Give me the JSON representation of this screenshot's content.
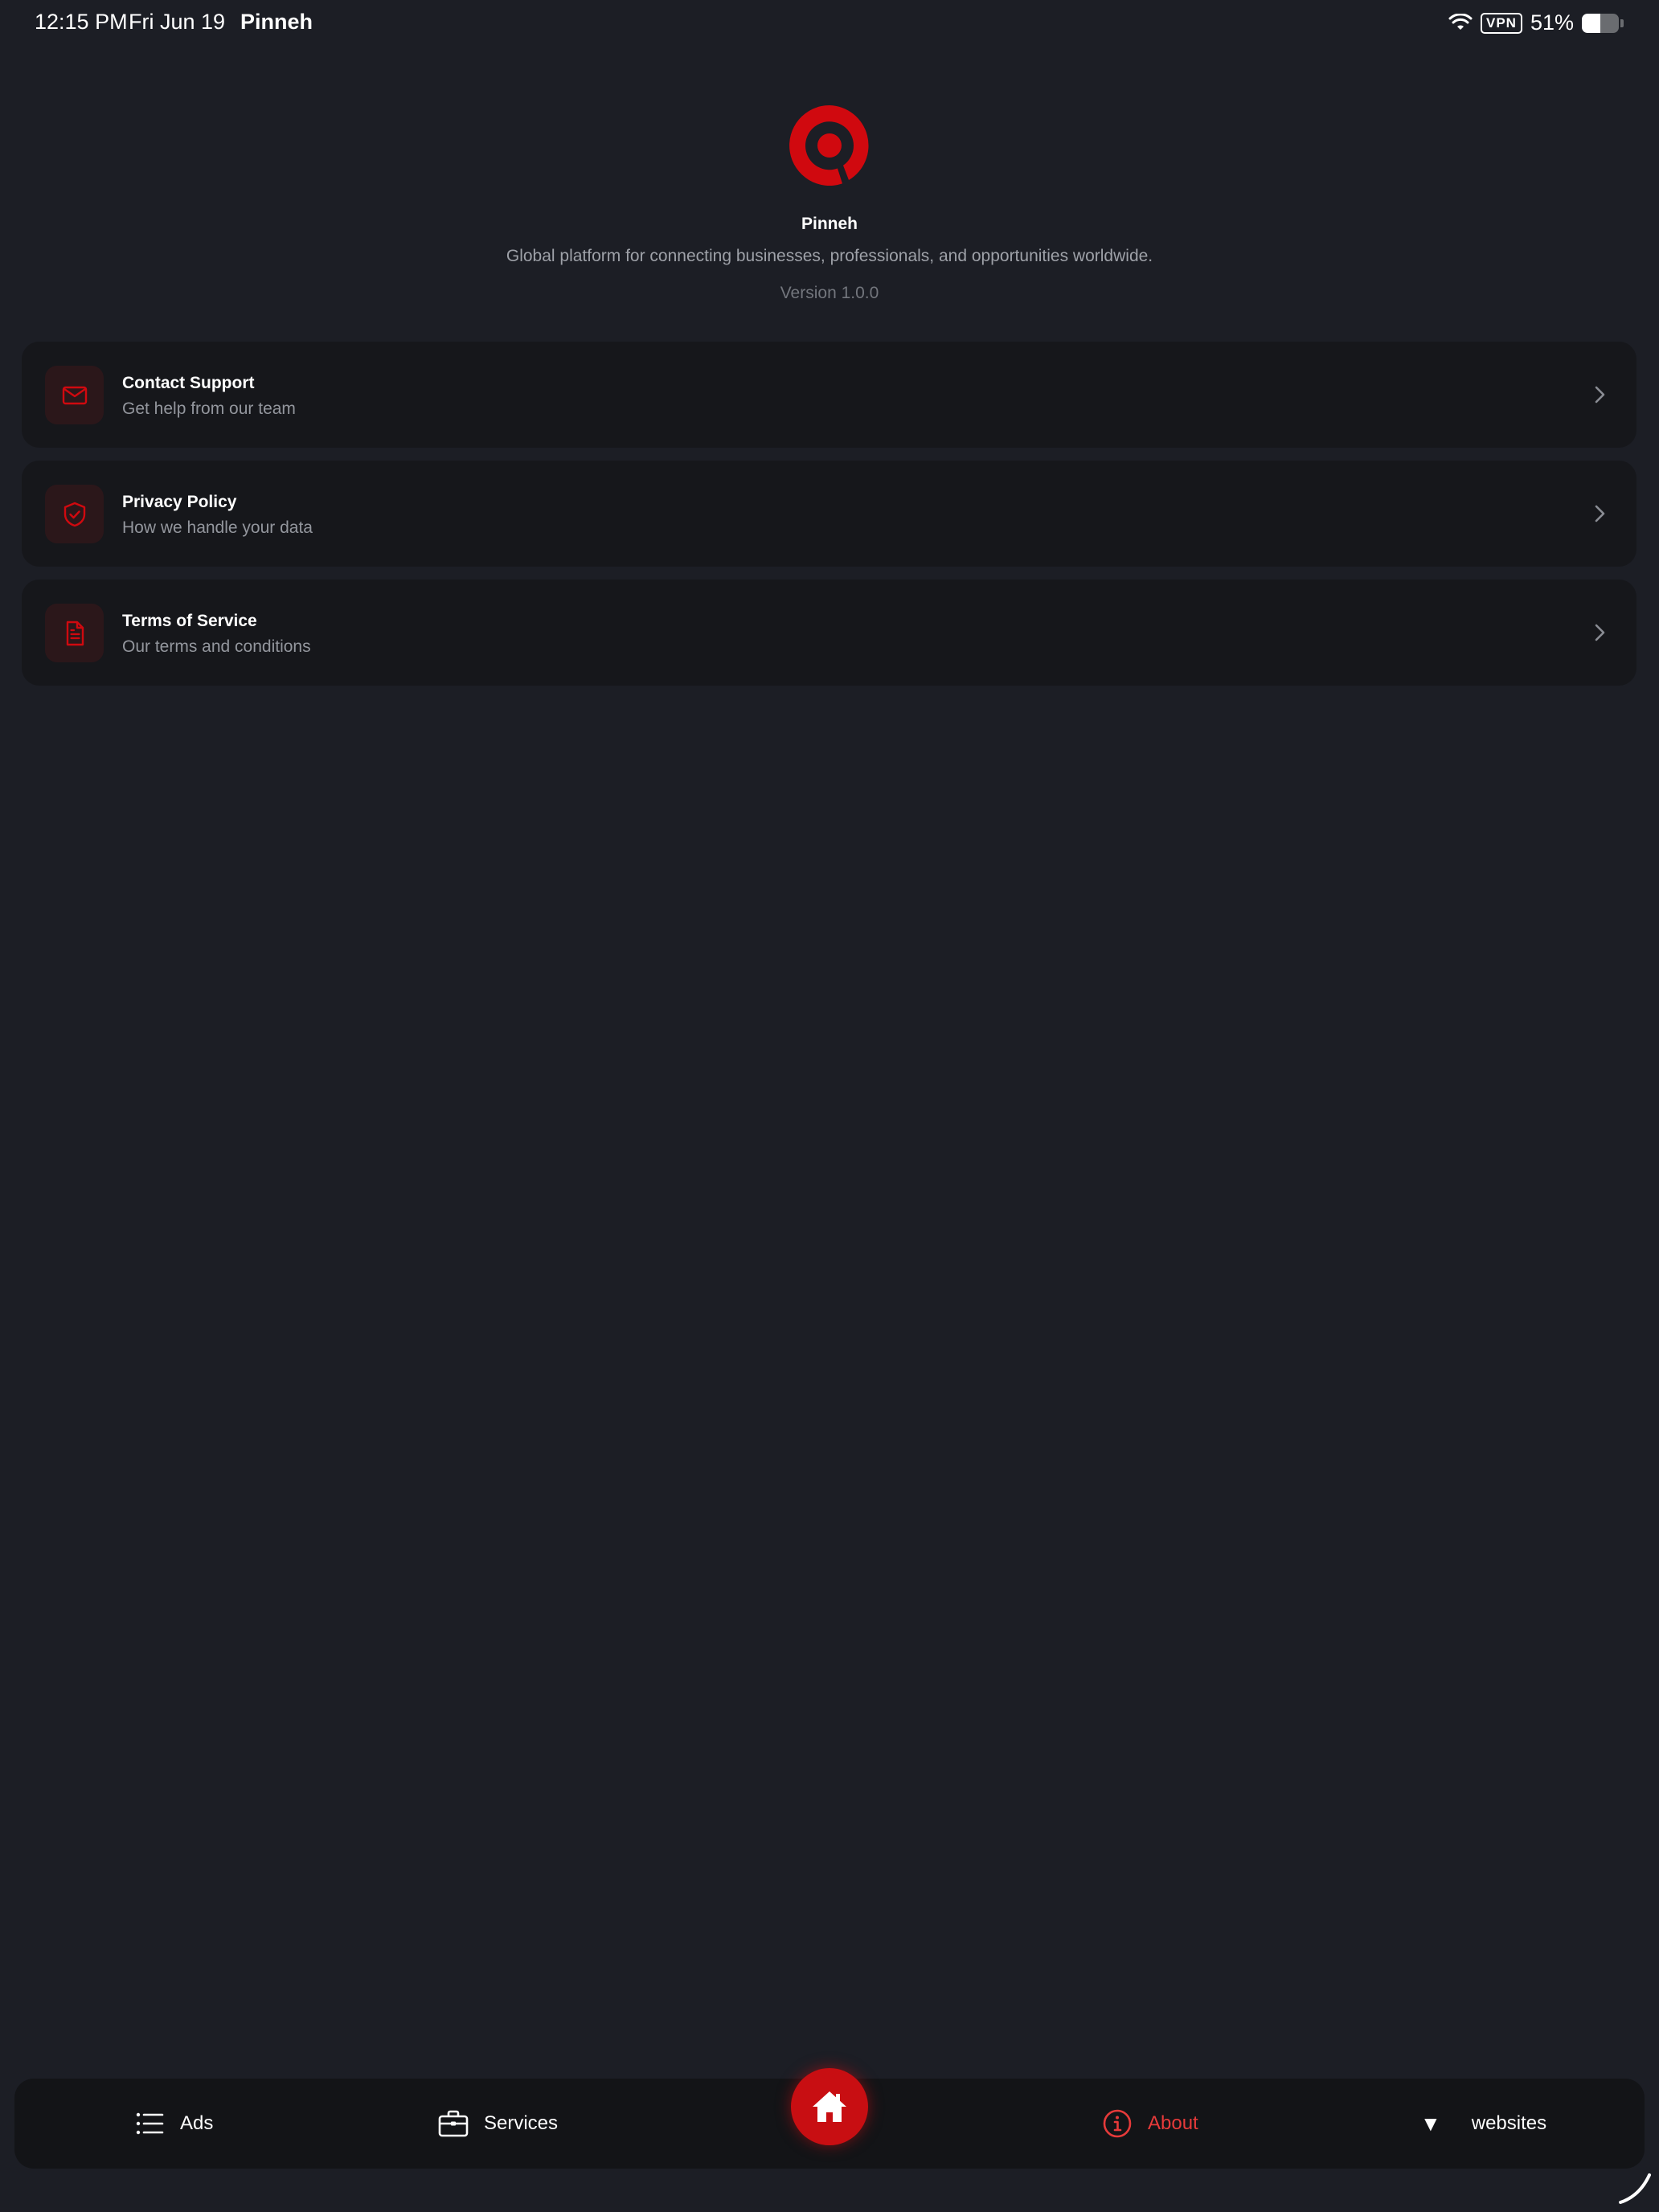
{
  "status_bar": {
    "time": "12:15 PM",
    "date": "Fri Jun 19",
    "app": "Pinneh",
    "vpn": "VPN",
    "battery_text": "51%",
    "battery_level": 0.51,
    "wifi_icon": "wifi-icon"
  },
  "header": {
    "logo_icon": "pinneh-logo",
    "app_name": "Pinneh",
    "description": "Global platform for connecting businesses, professionals, and opportunities worldwide.",
    "version": "Version 1.0.0"
  },
  "menu": {
    "items": [
      {
        "title": "Contact Support",
        "subtitle": "Get help from our team",
        "icon": "mail-icon"
      },
      {
        "title": "Privacy Policy",
        "subtitle": "How we handle your data",
        "icon": "shield-check-icon"
      },
      {
        "title": "Terms of Service",
        "subtitle": "Our terms and conditions",
        "icon": "document-icon"
      }
    ]
  },
  "tabbar": {
    "ads": "Ads",
    "services": "Services",
    "home_icon": "home-icon",
    "about": "About",
    "websites": "websites",
    "websites_marker": "▼"
  },
  "colors": {
    "background": "#1c1e25",
    "card": "#16171b",
    "accent": "#d0090f",
    "active_tab": "#e63a3a",
    "muted_text": "#93969d"
  }
}
